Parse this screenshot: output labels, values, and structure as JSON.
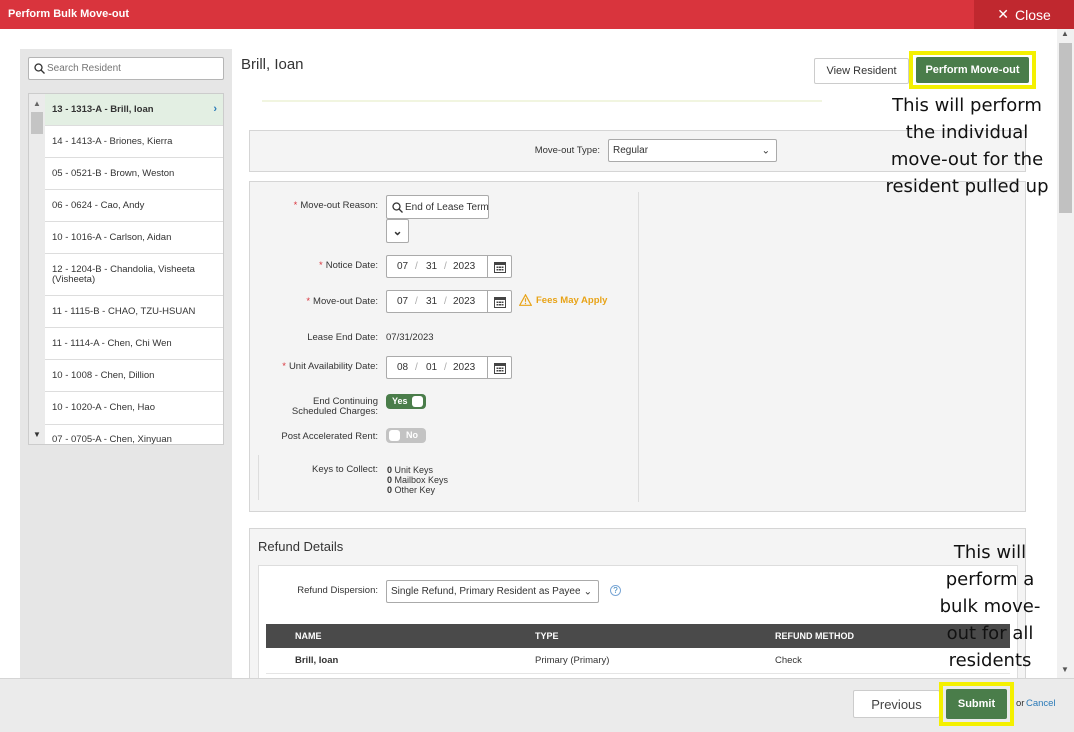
{
  "dialog": {
    "title": "Perform Bulk Move-out",
    "close_label": "Close"
  },
  "search": {
    "placeholder": "Search Resident"
  },
  "residents": [
    "13 - 1313-A - Brill, Ioan",
    "14 - 1413-A - Briones, Kierra",
    "05 - 0521-B - Brown, Weston",
    "06 - 0624 - Cao, Andy",
    "10 - 1016-A - Carlson, Aidan",
    "12 - 1204-B - Chandolia, Visheeta (Visheeta)",
    "11 - 1115-B - CHAO, TZU-HSUAN",
    "11 - 1114-A - Chen, Chi Wen",
    "10 - 1008 - Chen, Dillion",
    "10 - 1020-A - Chen, Hao",
    "07 - 0705-A - Chen, Xinyuan"
  ],
  "selected_resident": "Brill, Ioan",
  "header_buttons": {
    "view_resident": "View Resident",
    "perform_moveout": "Perform Move-out"
  },
  "moveout_type": {
    "label": "Move-out Type:",
    "value": "Regular"
  },
  "form": {
    "reason": {
      "label": "Move-out Reason:",
      "value": "End of Lease Term"
    },
    "notice_date": {
      "label": "Notice Date:",
      "mm": "07",
      "dd": "31",
      "yyyy": "2023"
    },
    "moveout_date": {
      "label": "Move-out Date:",
      "mm": "07",
      "dd": "31",
      "yyyy": "2023",
      "warning": "Fees May Apply"
    },
    "lease_end": {
      "label": "Lease End Date:",
      "value": "07/31/2023"
    },
    "unit_avail": {
      "label": "Unit Availability Date:",
      "mm": "08",
      "dd": "01",
      "yyyy": "2023"
    },
    "end_charges": {
      "label_1": "End Continuing",
      "label_2": "Scheduled Charges:",
      "value": "Yes"
    },
    "accel_rent": {
      "label": "Post Accelerated Rent:",
      "value": "No"
    },
    "keys": {
      "label": "Keys to Collect:",
      "items": [
        {
          "count": "0",
          "name": "Unit Keys"
        },
        {
          "count": "0",
          "name": "Mailbox Keys"
        },
        {
          "count": "0",
          "name": "Other Key"
        }
      ]
    }
  },
  "refund": {
    "heading": "Refund Details",
    "dispersion_label": "Refund Dispersion:",
    "dispersion_value": "Single Refund, Primary Resident as Payee",
    "columns": [
      "NAME",
      "TYPE",
      "REFUND METHOD"
    ],
    "rows": [
      {
        "name": "Brill, Ioan",
        "type": "Primary (Primary)",
        "method": "Check"
      }
    ]
  },
  "annotations": {
    "individual": "This will perform\nthe individual\nmove-out for the\nresident pulled up",
    "bulk": "This will\nperform a\nbulk move-\nout for all\nresidents"
  },
  "footer": {
    "previous": "Previous",
    "submit": "Submit",
    "or": "or",
    "cancel": "Cancel"
  },
  "colors": {
    "header_red": "#d9343d",
    "primary_green": "#4a7d4a",
    "highlight_yellow": "#f4f000",
    "link_blue": "#2a7ab8",
    "warning_orange": "#e8a317"
  }
}
